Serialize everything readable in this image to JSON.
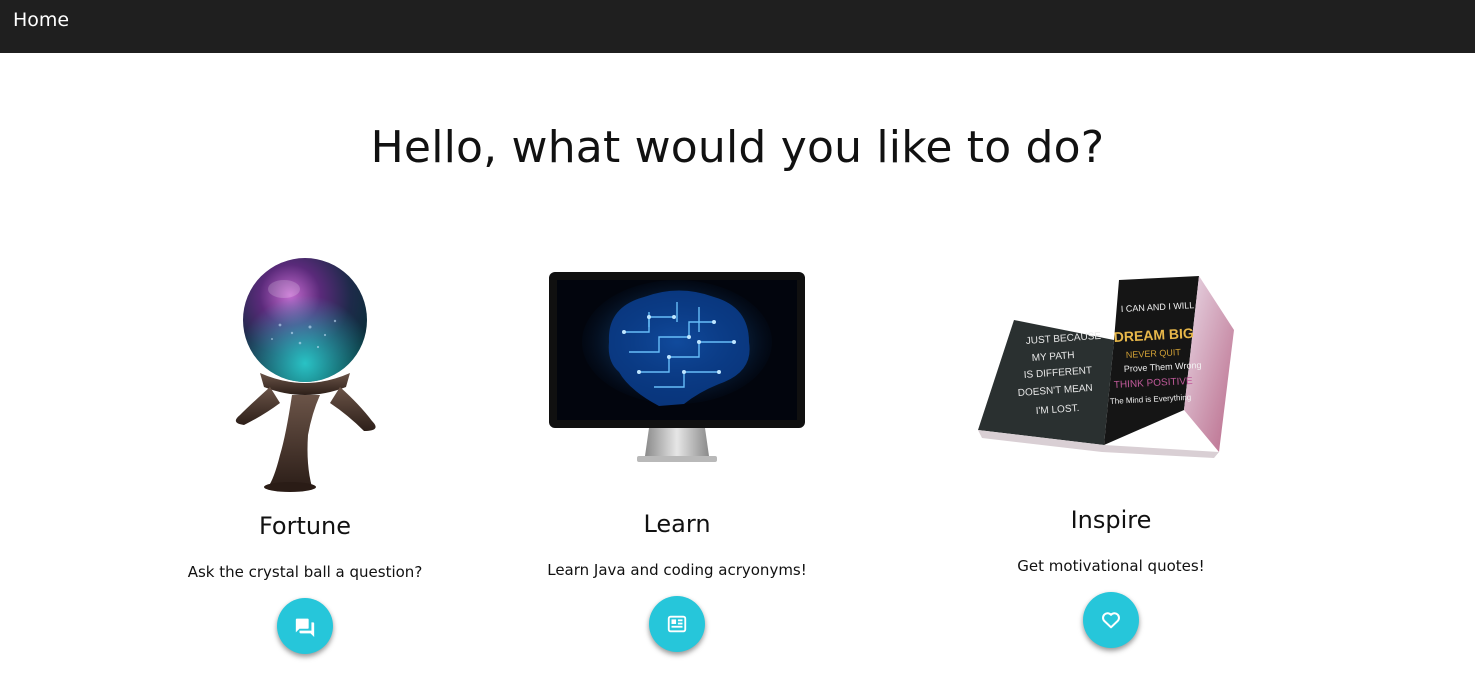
{
  "nav": {
    "home_label": "Home"
  },
  "main": {
    "title": "Hello, what would you like to do?"
  },
  "cards": [
    {
      "title": "Fortune",
      "description": "Ask the crystal ball a question?",
      "icon": "chat-icon",
      "image": "crystal-ball-image"
    },
    {
      "title": "Learn",
      "description": "Learn Java and coding acryonyms!",
      "icon": "news-icon",
      "image": "computer-monitor-brain-image"
    },
    {
      "title": "Inspire",
      "description": "Get motivational quotes!",
      "icon": "heart-icon",
      "image": "motivational-book-image",
      "book_left_page": [
        "JUST BECAUSE",
        "MY PATH",
        "IS DIFFERENT",
        "DOESN'T MEAN",
        "I'M LOST."
      ],
      "book_right_page": [
        "I CAN AND I WILL",
        "DREAM BIG",
        "NEVER QUIT",
        "Prove Them Wrong",
        "THINK POSITIVE",
        "The Mind is Everything"
      ]
    }
  ],
  "colors": {
    "navbar": "#1f1f1f",
    "fab": "#26c6da"
  }
}
